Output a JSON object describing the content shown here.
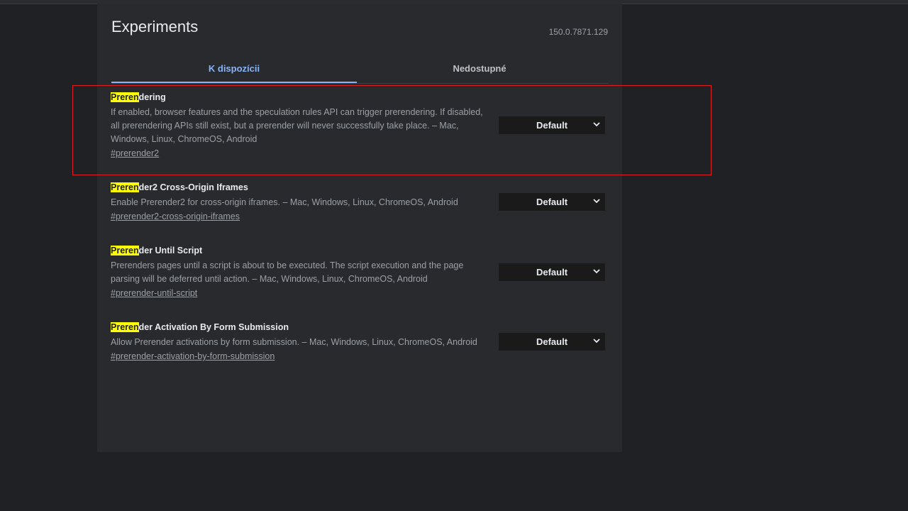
{
  "header": {
    "title": "Experiments",
    "version": "150.0.7871.129"
  },
  "tabs": [
    {
      "label": "K dispozícii",
      "active": true
    },
    {
      "label": "Nedostupné",
      "active": false
    }
  ],
  "search_highlight": "Preren",
  "experiments": [
    {
      "title_highlight": "Preren",
      "title_rest": "dering",
      "description": "If enabled, browser features and the speculation rules API can trigger prerendering. If disabled, all prerendering APIs still exist, but a prerender will never successfully take place. – Mac, Windows, Linux, ChromeOS, Android",
      "link": "#prerender2",
      "select_value": "Default"
    },
    {
      "title_highlight": "Preren",
      "title_rest": "der2 Cross-Origin Iframes",
      "description": "Enable Prerender2 for cross-origin iframes. – Mac, Windows, Linux, ChromeOS, Android",
      "link": "#prerender2-cross-origin-iframes",
      "select_value": "Default"
    },
    {
      "title_highlight": "Preren",
      "title_rest": "der Until Script",
      "description": "Prerenders pages until a script is about to be executed. The script execution and the page parsing will be deferred until action. – Mac, Windows, Linux, ChromeOS, Android",
      "link": "#prerender-until-script",
      "select_value": "Default"
    },
    {
      "title_highlight": "Preren",
      "title_rest": "der Activation By Form Submission",
      "description": "Allow Prerender activations by form submission. – Mac, Windows, Linux, ChromeOS, Android",
      "link": "#prerender-activation-by-form-submission",
      "select_value": "Default"
    }
  ],
  "icons": {
    "select_chevron": "chevron-down-icon"
  },
  "colors": {
    "background": "#202124",
    "panel": "#292a2d",
    "accent": "#8ab4f8",
    "highlight": "#ffff00",
    "annotation": "#e02020"
  }
}
